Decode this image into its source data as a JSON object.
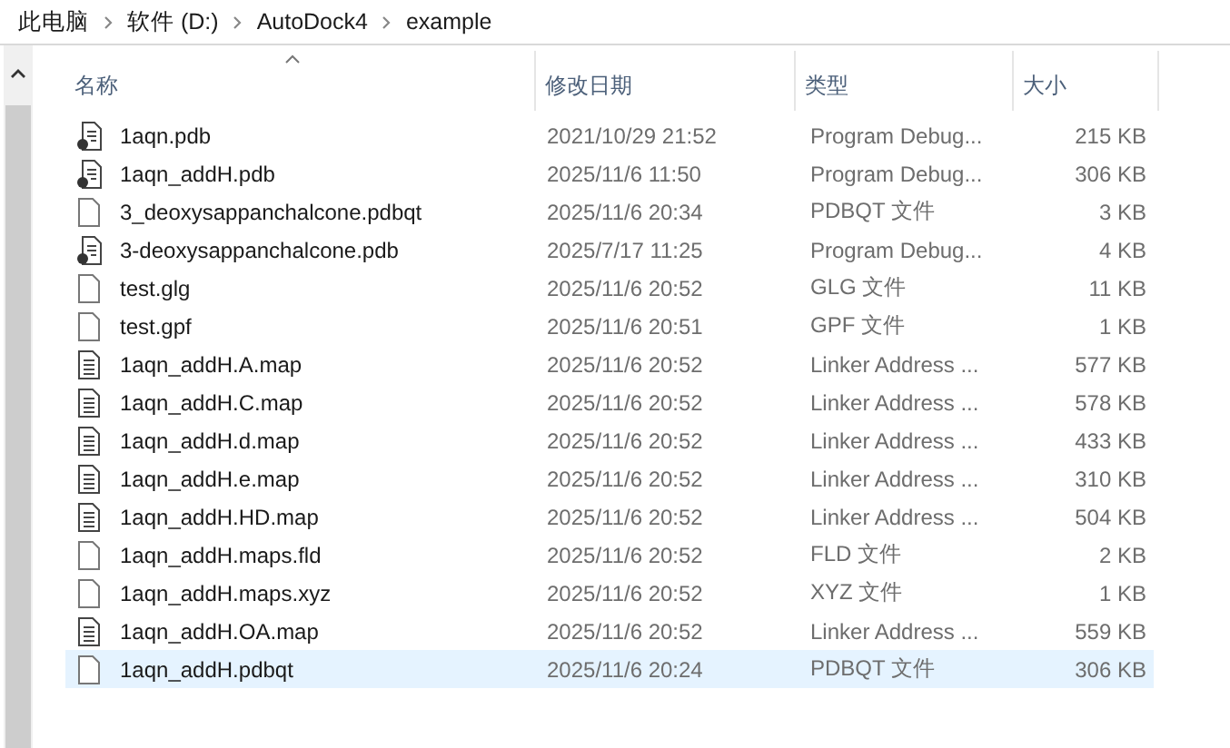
{
  "breadcrumb": [
    "此电脑",
    "软件 (D:)",
    "AutoDock4",
    "example"
  ],
  "columns": [
    {
      "label": "名称",
      "sorted": true
    },
    {
      "label": "修改日期",
      "sorted": false
    },
    {
      "label": "类型",
      "sorted": false
    },
    {
      "label": "大小",
      "sorted": false
    }
  ],
  "rows": [
    {
      "name": "1aqn.pdb",
      "date": "2021/10/29 21:52",
      "type": "Program Debug...",
      "size": "215 KB",
      "kind": "pdb",
      "selected": false
    },
    {
      "name": "1aqn_addH.pdb",
      "date": "2025/11/6 11:50",
      "type": "Program Debug...",
      "size": "306 KB",
      "kind": "pdb",
      "selected": false
    },
    {
      "name": "3_deoxysappanchalcone.pdbqt",
      "date": "2025/11/6 20:34",
      "type": "PDBQT 文件",
      "size": "3 KB",
      "kind": "blank",
      "selected": false
    },
    {
      "name": "3-deoxysappanchalcone.pdb",
      "date": "2025/7/17 11:25",
      "type": "Program Debug...",
      "size": "4 KB",
      "kind": "pdb",
      "selected": false
    },
    {
      "name": "test.glg",
      "date": "2025/11/6 20:52",
      "type": "GLG 文件",
      "size": "11 KB",
      "kind": "blank",
      "selected": false
    },
    {
      "name": "test.gpf",
      "date": "2025/11/6 20:51",
      "type": "GPF 文件",
      "size": "1 KB",
      "kind": "blank",
      "selected": false
    },
    {
      "name": "1aqn_addH.A.map",
      "date": "2025/11/6 20:52",
      "type": "Linker Address ...",
      "size": "577 KB",
      "kind": "text",
      "selected": false
    },
    {
      "name": "1aqn_addH.C.map",
      "date": "2025/11/6 20:52",
      "type": "Linker Address ...",
      "size": "578 KB",
      "kind": "text",
      "selected": false
    },
    {
      "name": "1aqn_addH.d.map",
      "date": "2025/11/6 20:52",
      "type": "Linker Address ...",
      "size": "433 KB",
      "kind": "text",
      "selected": false
    },
    {
      "name": "1aqn_addH.e.map",
      "date": "2025/11/6 20:52",
      "type": "Linker Address ...",
      "size": "310 KB",
      "kind": "text",
      "selected": false
    },
    {
      "name": "1aqn_addH.HD.map",
      "date": "2025/11/6 20:52",
      "type": "Linker Address ...",
      "size": "504 KB",
      "kind": "text",
      "selected": false
    },
    {
      "name": "1aqn_addH.maps.fld",
      "date": "2025/11/6 20:52",
      "type": "FLD 文件",
      "size": "2 KB",
      "kind": "blank",
      "selected": false
    },
    {
      "name": "1aqn_addH.maps.xyz",
      "date": "2025/11/6 20:52",
      "type": "XYZ 文件",
      "size": "1 KB",
      "kind": "blank",
      "selected": false
    },
    {
      "name": "1aqn_addH.OA.map",
      "date": "2025/11/6 20:52",
      "type": "Linker Address ...",
      "size": "559 KB",
      "kind": "text",
      "selected": false
    },
    {
      "name": "1aqn_addH.pdbqt",
      "date": "2025/11/6 20:24",
      "type": "PDBQT 文件",
      "size": "306 KB",
      "kind": "blank",
      "selected": true
    }
  ]
}
